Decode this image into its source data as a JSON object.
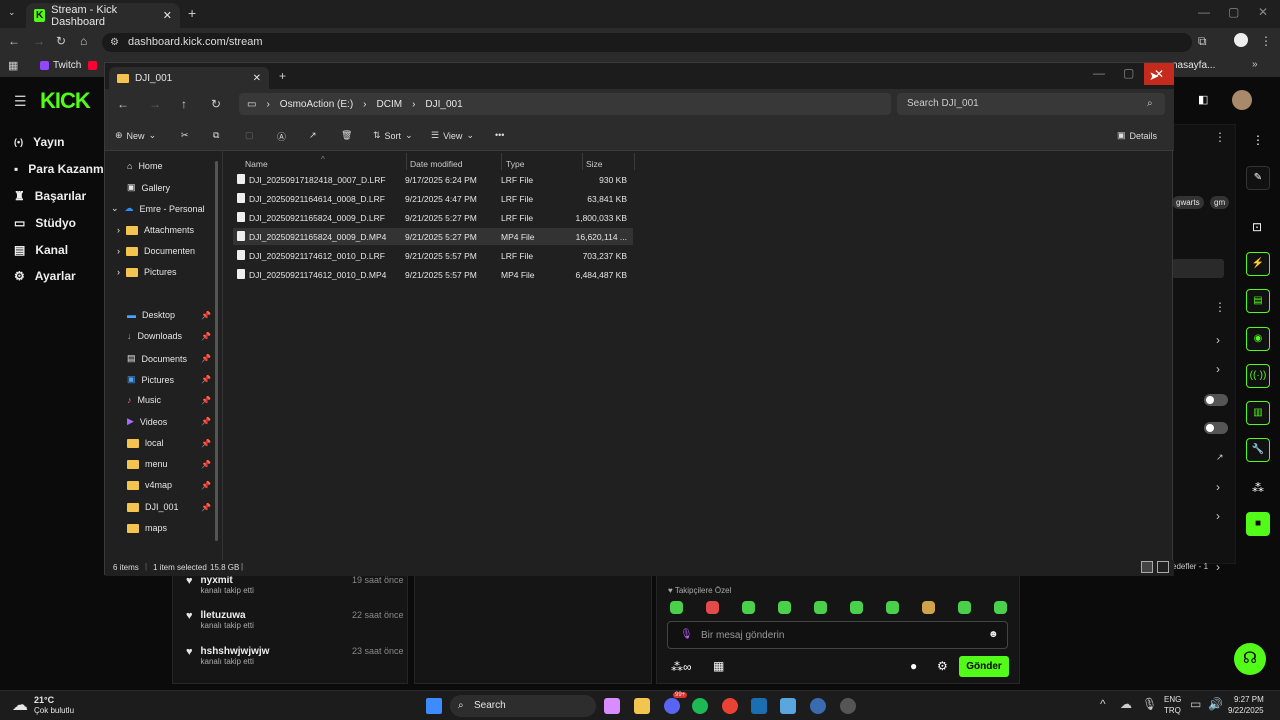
{
  "browser": {
    "tab_title": "Stream - Kick Dashboard",
    "url": "dashboard.kick.com/stream",
    "bookmarks": [
      {
        "label": "Twitch"
      },
      {
        "label": "nasayfa..."
      }
    ]
  },
  "kick": {
    "logo": "KICK",
    "nav": [
      {
        "label": "Yayın",
        "icon": "broadcast-icon"
      },
      {
        "label": "Para Kazanm",
        "icon": "money-icon"
      },
      {
        "label": "Başarılar",
        "icon": "trophy-icon"
      },
      {
        "label": "Stüdyo",
        "icon": "studio-icon"
      },
      {
        "label": "Kanal",
        "icon": "channel-icon"
      },
      {
        "label": "Ayarlar",
        "icon": "gear-icon"
      }
    ],
    "tags": [
      "gwarts",
      "gm"
    ],
    "activity": [
      {
        "name": "nyxmit",
        "action": "kanalı takip etti",
        "time": "19 saat önce"
      },
      {
        "name": "lletuzuwa",
        "action": "kanalı takip etti",
        "time": "22 saat önce"
      },
      {
        "name": "hshshwjwjwjw",
        "action": "kanalı takip etti",
        "time": "23 saat önce"
      }
    ],
    "chat": {
      "mode": "Takipçilere Özel",
      "placeholder": "Bir mesaj gönderin",
      "send": "Gönder"
    },
    "goals_label": "edefler - 1"
  },
  "explorer": {
    "tab_title": "DJI_001",
    "breadcrumb": [
      "OsmoAction (E:)",
      "DCIM",
      "DJI_001"
    ],
    "search_placeholder": "Search DJI_001",
    "commands": {
      "new": "New",
      "sort": "Sort",
      "view": "View",
      "details": "Details"
    },
    "sidebar": [
      {
        "label": "Home"
      },
      {
        "label": "Gallery"
      },
      {
        "label": "Emre - Personal"
      },
      {
        "label": "Attachments"
      },
      {
        "label": "Documenten"
      },
      {
        "label": "Pictures"
      },
      {
        "label": "Desktop"
      },
      {
        "label": "Downloads"
      },
      {
        "label": "Documents"
      },
      {
        "label": "Pictures"
      },
      {
        "label": "Music"
      },
      {
        "label": "Videos"
      },
      {
        "label": "local"
      },
      {
        "label": "menu"
      },
      {
        "label": "v4map"
      },
      {
        "label": "DJI_001"
      },
      {
        "label": "maps"
      }
    ],
    "columns": {
      "name": "Name",
      "date": "Date modified",
      "type": "Type",
      "size": "Size"
    },
    "files": [
      {
        "name": "DJI_20250917182418_0007_D.LRF",
        "date": "9/17/2025 6:24 PM",
        "type": "LRF File",
        "size": "930 KB"
      },
      {
        "name": "DJI_20250921164614_0008_D.LRF",
        "date": "9/21/2025 4:47 PM",
        "type": "LRF File",
        "size": "63,841 KB"
      },
      {
        "name": "DJI_20250921165824_0009_D.LRF",
        "date": "9/21/2025 5:27 PM",
        "type": "LRF File",
        "size": "1,800,033 KB"
      },
      {
        "name": "DJI_20250921165824_0009_D.MP4",
        "date": "9/21/2025 5:27 PM",
        "type": "MP4 File",
        "size": "16,620,114 ..."
      },
      {
        "name": "DJI_20250921174612_0010_D.LRF",
        "date": "9/21/2025 5:57 PM",
        "type": "LRF File",
        "size": "703,237 KB"
      },
      {
        "name": "DJI_20250921174612_0010_D.MP4",
        "date": "9/21/2025 5:57 PM",
        "type": "MP4 File",
        "size": "6,484,487 KB"
      }
    ],
    "status": {
      "items": "6 items",
      "selected": "1 item selected",
      "size": "15.8 GB"
    }
  },
  "taskbar": {
    "weather_temp": "21°C",
    "weather_desc": "Çok bulutlu",
    "search": "Search",
    "lang": "ENG",
    "region": "TRQ",
    "time": "9:27 PM",
    "date": "9/22/2025",
    "badge": "99+"
  },
  "colors": {
    "accent": "#53fc18",
    "close": "#c42b1c",
    "folder": "#f3c44f"
  }
}
